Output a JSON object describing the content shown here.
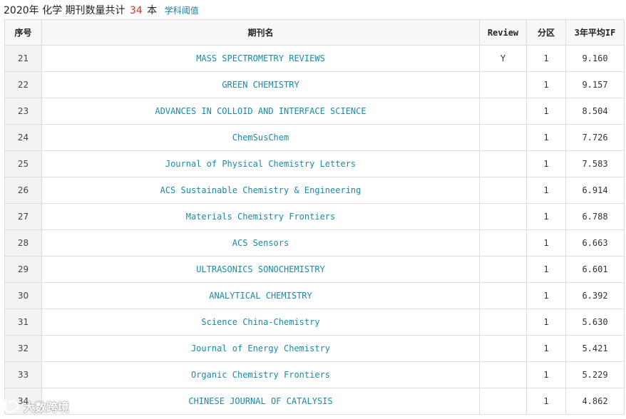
{
  "header": {
    "year": "2020年",
    "subject": "化学",
    "count_prefix": "期刊数量共计",
    "count": "34",
    "count_suffix": "本",
    "threshold_link": "学科阈值"
  },
  "table": {
    "columns": [
      "序号",
      "期刊名",
      "Review",
      "分区",
      "3年平均IF"
    ],
    "rows": [
      {
        "seq": "21",
        "name": "MASS SPECTROMETRY REVIEWS",
        "review": "Y",
        "zone": "1",
        "avg_if": "9.160"
      },
      {
        "seq": "22",
        "name": "GREEN CHEMISTRY",
        "review": "",
        "zone": "1",
        "avg_if": "9.157"
      },
      {
        "seq": "23",
        "name": "ADVANCES IN COLLOID AND INTERFACE SCIENCE",
        "review": "",
        "zone": "1",
        "avg_if": "8.504"
      },
      {
        "seq": "24",
        "name": "ChemSusChem",
        "review": "",
        "zone": "1",
        "avg_if": "7.726"
      },
      {
        "seq": "25",
        "name": "Journal of Physical Chemistry Letters",
        "review": "",
        "zone": "1",
        "avg_if": "7.583"
      },
      {
        "seq": "26",
        "name": "ACS Sustainable Chemistry & Engineering",
        "review": "",
        "zone": "1",
        "avg_if": "6.914"
      },
      {
        "seq": "27",
        "name": "Materials Chemistry Frontiers",
        "review": "",
        "zone": "1",
        "avg_if": "6.788"
      },
      {
        "seq": "28",
        "name": "ACS Sensors",
        "review": "",
        "zone": "1",
        "avg_if": "6.663"
      },
      {
        "seq": "29",
        "name": "ULTRASONICS SONOCHEMISTRY",
        "review": "",
        "zone": "1",
        "avg_if": "6.601"
      },
      {
        "seq": "30",
        "name": "ANALYTICAL CHEMISTRY",
        "review": "",
        "zone": "1",
        "avg_if": "6.392"
      },
      {
        "seq": "31",
        "name": "Science China-Chemistry",
        "review": "",
        "zone": "1",
        "avg_if": "5.630"
      },
      {
        "seq": "32",
        "name": "Journal of Energy Chemistry",
        "review": "",
        "zone": "1",
        "avg_if": "5.421"
      },
      {
        "seq": "33",
        "name": "Organic Chemistry Frontiers",
        "review": "",
        "zone": "1",
        "avg_if": "5.229"
      },
      {
        "seq": "34",
        "name": "CHINESE JOURNAL OF CATALYSIS",
        "review": "",
        "zone": "1",
        "avg_if": "4.862"
      }
    ]
  },
  "watermark": {
    "text": "大数跨境",
    "icon": "brand-logo-icon"
  },
  "colors": {
    "link": "#1a8aa8",
    "count": "#c0392b",
    "border": "#dddddd",
    "seq_bg": "#f3f3f3"
  }
}
